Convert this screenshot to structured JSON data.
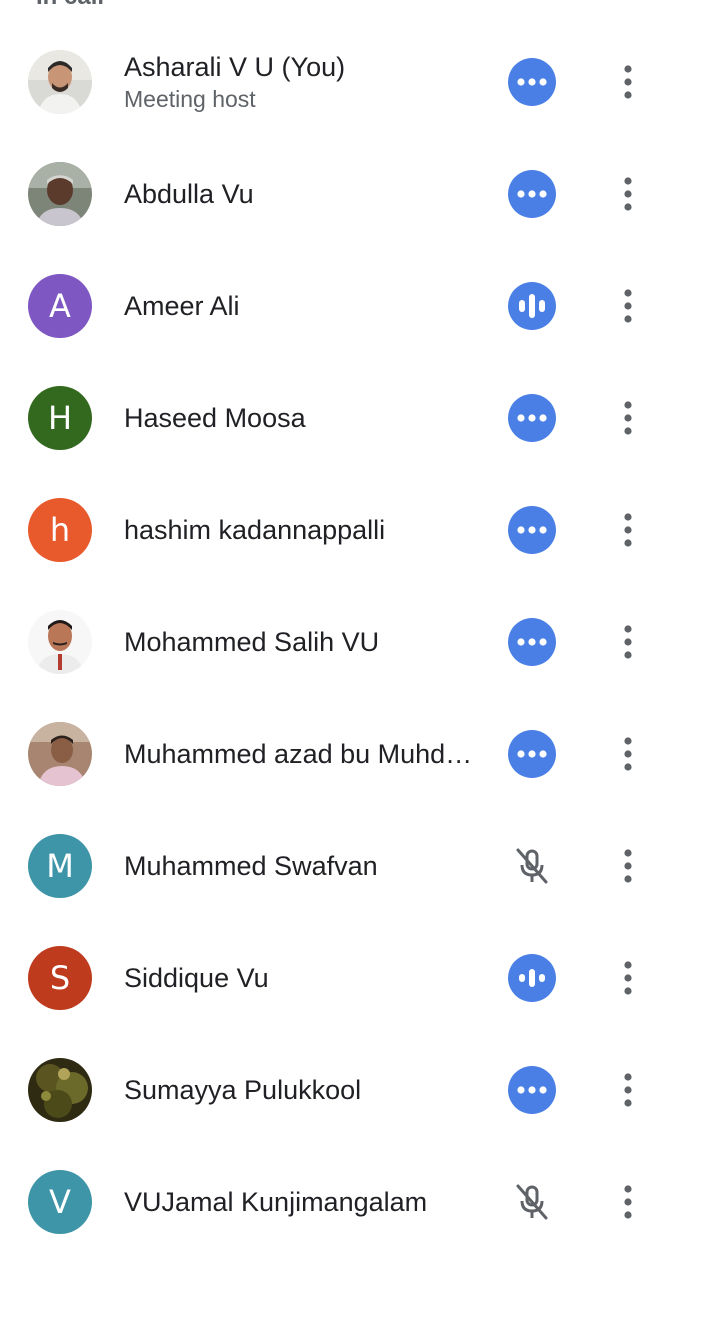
{
  "section": {
    "header": "In call"
  },
  "colors": {
    "accent": "#4a7fe5",
    "icon_gray": "#5f6368"
  },
  "participants": [
    {
      "name": "Asharali V U (You)",
      "subtitle": "Meeting host",
      "avatar": "photo",
      "status": "more-dots-icon"
    },
    {
      "name": "Abdulla Vu",
      "subtitle": "",
      "avatar": "photo",
      "status": "more-dots-icon"
    },
    {
      "name": "Ameer Ali",
      "subtitle": "",
      "avatar_initial": "A",
      "avatar_color": "#7e57c2",
      "status": "speaking-bars-icon"
    },
    {
      "name": "Haseed Moosa",
      "subtitle": "",
      "avatar_initial": "H",
      "avatar_color": "#33691e",
      "status": "more-dots-icon"
    },
    {
      "name": "hashim kadannappalli",
      "subtitle": "",
      "avatar_initial": "h",
      "avatar_color": "#e8592b",
      "status": "more-dots-icon"
    },
    {
      "name": "Mohammed Salih VU",
      "subtitle": "",
      "avatar": "photo",
      "status": "more-dots-icon"
    },
    {
      "name": "Muhammed azad bu Muhd…",
      "subtitle": "",
      "avatar": "photo",
      "status": "more-dots-icon"
    },
    {
      "name": "Muhammed Swafvan",
      "subtitle": "",
      "avatar_initial": "M",
      "avatar_color": "#3f95a8",
      "status": "mic-off-icon"
    },
    {
      "name": "Siddique Vu",
      "subtitle": "",
      "avatar_initial": "S",
      "avatar_color": "#bf3b1e",
      "status": "speaking-bars-icon"
    },
    {
      "name": "Sumayya Pulukkool",
      "subtitle": "",
      "avatar": "photo",
      "status": "more-dots-icon"
    },
    {
      "name": "VUJamal Kunjimangalam",
      "subtitle": "",
      "avatar_initial": "V",
      "avatar_color": "#3f95a8",
      "status": "mic-off-icon"
    }
  ]
}
